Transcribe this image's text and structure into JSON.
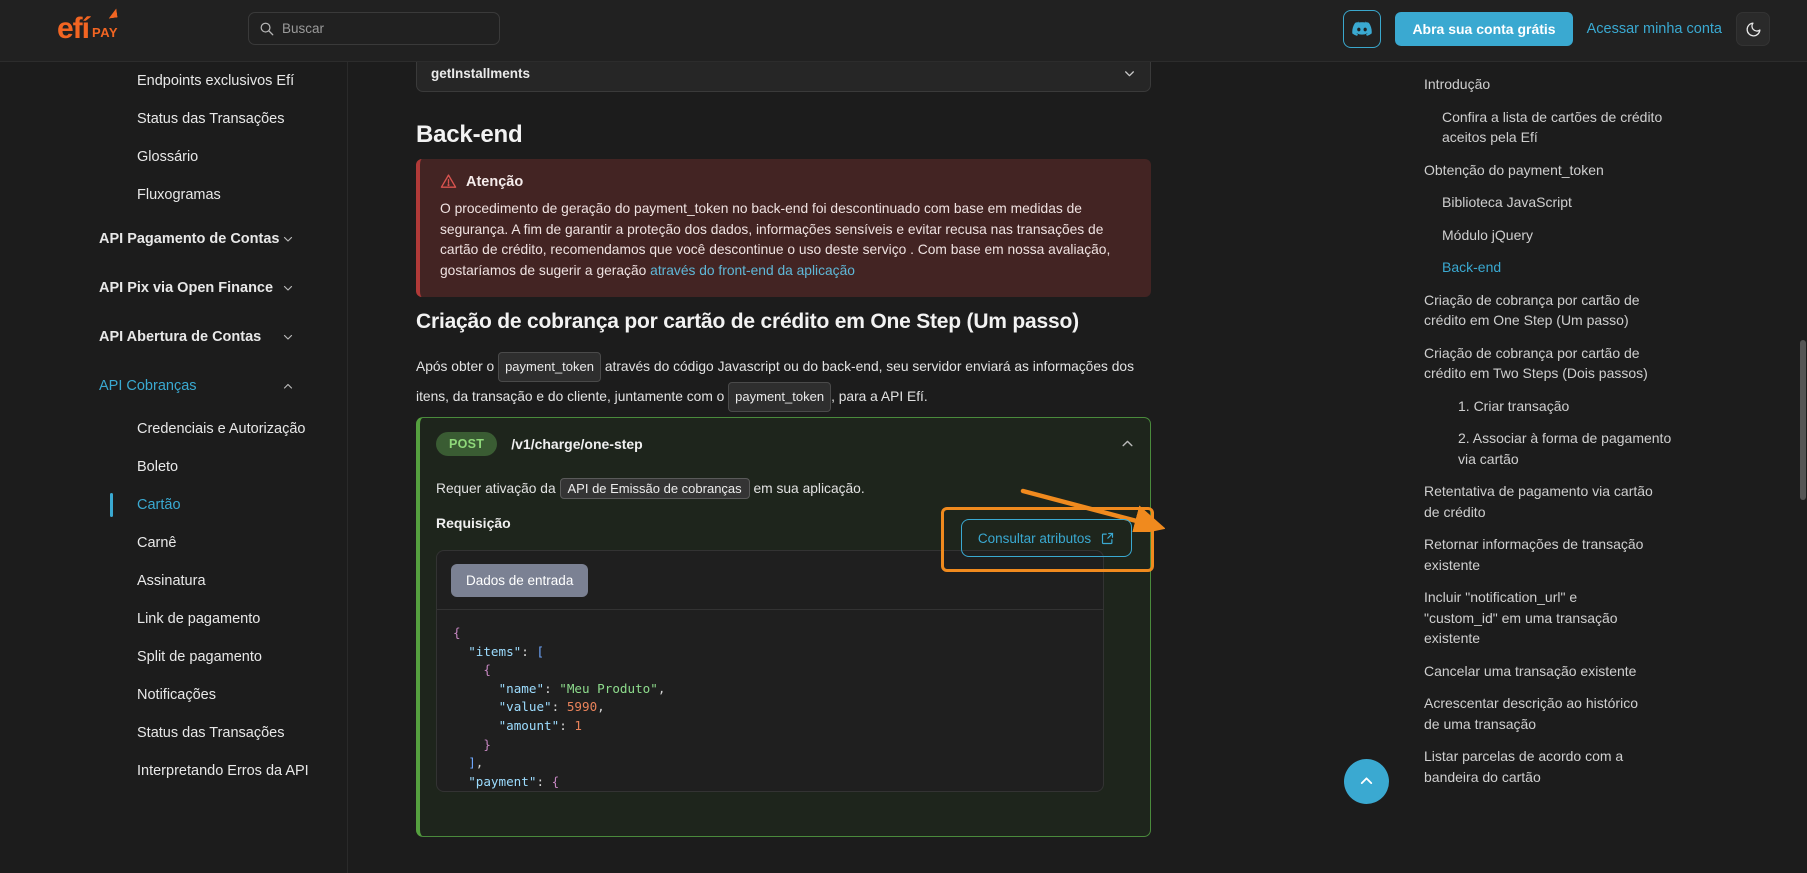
{
  "header": {
    "logo_main": "efí",
    "logo_sub": "PAY",
    "search_placeholder": "Buscar",
    "cta_label": "Abra sua conta grátis",
    "login_label": "Acessar minha conta"
  },
  "sidebar": {
    "items": [
      {
        "label": "Endpoints exclusivos Efí",
        "level": "child",
        "state": ""
      },
      {
        "label": "Status das Transações",
        "level": "child",
        "state": ""
      },
      {
        "label": "Glossário",
        "level": "child",
        "state": ""
      },
      {
        "label": "Fluxogramas",
        "level": "child",
        "state": ""
      },
      {
        "label": "API Pagamento de Contas",
        "level": "group",
        "state": "collapsed"
      },
      {
        "label": "API Pix via Open Finance",
        "level": "group",
        "state": "collapsed"
      },
      {
        "label": "API Abertura de Contas",
        "level": "group",
        "state": "collapsed"
      },
      {
        "label": "API Cobranças",
        "level": "group",
        "state": "expanded"
      },
      {
        "label": "Credenciais e Autorização",
        "level": "child",
        "state": ""
      },
      {
        "label": "Boleto",
        "level": "child",
        "state": ""
      },
      {
        "label": "Cartão",
        "level": "child",
        "state": "selected"
      },
      {
        "label": "Carnê",
        "level": "child",
        "state": ""
      },
      {
        "label": "Assinatura",
        "level": "child",
        "state": ""
      },
      {
        "label": "Link de pagamento",
        "level": "child",
        "state": ""
      },
      {
        "label": "Split de pagamento",
        "level": "child",
        "state": ""
      },
      {
        "label": "Notificações",
        "level": "child",
        "state": ""
      },
      {
        "label": "Status das Transações",
        "level": "child",
        "state": ""
      },
      {
        "label": "Interpretando Erros da API",
        "level": "child",
        "state": ""
      }
    ]
  },
  "main": {
    "version_selector_value": "getInstallments",
    "backend_heading": "Back-end",
    "alert": {
      "title": "Atenção",
      "text_part1": "O procedimento de geração do payment_token no back-end foi descontinuado com base em medidas de segurança. A fim de garantir a proteção dos dados, informações sensíveis e evitar recusa nas transações de cartão de crédito, recomendamos que você descontinue o uso deste serviço . Com base em nossa avaliação, gostaríamos de sugerir a geração ",
      "link_text": "através do front-end da aplicação"
    },
    "section_heading": "Criação de cobrança por cartão de crédito em One Step (Um passo)",
    "paragraph": {
      "p1": "Após obter o ",
      "token1": "payment_token",
      "p2": " através do código Javascript ou do back-end, seu servidor enviará as informações dos itens, da transação e do cliente, juntamente com o ",
      "token2": "payment_token",
      "p3": ", para a API Efí."
    },
    "endpoint": {
      "method": "POST",
      "path": "/v1/charge/one-step",
      "requires_prefix": "Requer ativação da ",
      "requires_link": "API de Emissão de cobranças",
      "requires_suffix": " em sua aplicação.",
      "request_label": "Requisição",
      "code_tab_label": "Dados de entrada",
      "code_lines": [
        "{",
        "  \"items\": [",
        "    {",
        "      \"name\": \"Meu Produto\",",
        "      \"value\": 5990,",
        "      \"amount\": 1",
        "    }",
        "  ],",
        "  \"payment\": {"
      ]
    },
    "annotation_button_label": "Consultar atributos"
  },
  "toc": {
    "items": [
      {
        "label": "Introdução",
        "level": "l1",
        "active": false
      },
      {
        "label": "Confira a lista de cartões de crédito aceitos pela Efí",
        "level": "l2",
        "active": false
      },
      {
        "label": "Obtenção do payment_token",
        "level": "l1",
        "active": false
      },
      {
        "label": "Biblioteca JavaScript",
        "level": "l2",
        "active": false
      },
      {
        "label": "Módulo jQuery",
        "level": "l2",
        "active": false
      },
      {
        "label": "Back-end",
        "level": "l2",
        "active": true
      },
      {
        "label": "Criação de cobrança por cartão de crédito em One Step (Um passo)",
        "level": "l1",
        "active": false
      },
      {
        "label": "Criação de cobrança por cartão de crédito em Two Steps (Dois passos)",
        "level": "l1",
        "active": false
      },
      {
        "label": "1. Criar transação",
        "level": "l3",
        "active": false
      },
      {
        "label": "2. Associar à forma de pagamento via cartão",
        "level": "l3",
        "active": false
      },
      {
        "label": "Retentativa de pagamento via cartão de crédito",
        "level": "l1",
        "active": false
      },
      {
        "label": "Retornar informações de transação existente",
        "level": "l1",
        "active": false
      },
      {
        "label": "Incluir \"notification_url\" e \"custom_id\" em uma transação existente",
        "level": "l1",
        "active": false
      },
      {
        "label": "Cancelar uma transação existente",
        "level": "l1",
        "active": false
      },
      {
        "label": "Acrescentar descrição ao histórico de uma transação",
        "level": "l1",
        "active": false
      },
      {
        "label": "Listar parcelas de acordo com a bandeira do cartão",
        "level": "l1",
        "active": false
      }
    ]
  },
  "colors": {
    "accent": "#3aa9d1",
    "brand_orange": "#F26522",
    "annotation_orange": "#F08A1E",
    "alert_bg": "#432423",
    "endpoint_green": "#55a03f"
  }
}
